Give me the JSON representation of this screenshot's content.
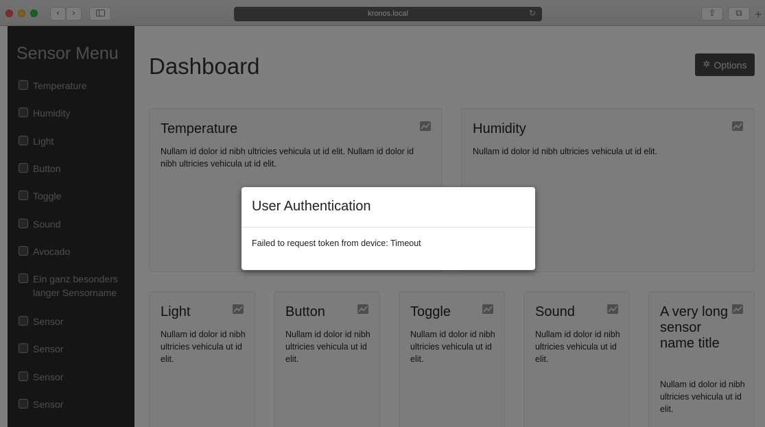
{
  "browser": {
    "url": "kronos.local",
    "back_glyph": "‹",
    "forward_glyph": "›",
    "reload_glyph": "↻",
    "share_glyph": "⇪",
    "tabs_glyph": "⧉",
    "new_tab_glyph": "+"
  },
  "sidebar": {
    "title": "Sensor Menu",
    "items": [
      {
        "label": "Temperature",
        "checked": false
      },
      {
        "label": "Humidity",
        "checked": false
      },
      {
        "label": "Light",
        "checked": false
      },
      {
        "label": "Button",
        "checked": false
      },
      {
        "label": "Toggle",
        "checked": false
      },
      {
        "label": "Sound",
        "checked": false
      },
      {
        "label": "Avocado",
        "checked": false
      },
      {
        "label": "Ein ganz besonders langer Sensorname",
        "checked": false
      },
      {
        "label": "Sensor",
        "checked": false
      },
      {
        "label": "Sensor",
        "checked": false
      },
      {
        "label": "Sensor",
        "checked": false
      },
      {
        "label": "Sensor",
        "checked": false
      }
    ]
  },
  "main": {
    "title": "Dashboard",
    "options_label": "Options",
    "options_icon": "gear-icon",
    "cards": [
      {
        "title": "Temperature",
        "text": "Nullam id dolor id nibh ultricies vehicula ut id elit. Nullam id dolor id nibh ultricies vehicula ut id elit."
      },
      {
        "title": "Humidity",
        "text": "Nullam id dolor id nibh ultricies vehicula ut id elit."
      },
      {
        "title": "Light",
        "text": "Nullam id dolor id nibh ultricies vehicula ut id elit."
      },
      {
        "title": "Button",
        "text": "Nullam id dolor id nibh ultricies vehicula ut id elit."
      },
      {
        "title": "Toggle",
        "text": "Nullam id dolor id nibh ultricies vehicula ut id elit."
      },
      {
        "title": "Sound",
        "text": "Nullam id dolor id nibh ultricies vehicula ut id elit."
      },
      {
        "title": "A very long sensor name title",
        "text": "Nullam id dolor id nibh ultricies vehicula ut id elit."
      }
    ]
  },
  "modal": {
    "title": "User Authentication",
    "message": "Failed to request token from device: Timeout"
  },
  "colors": {
    "sidebar_bg": "#2b2b2b",
    "overlay": "rgba(0,0,0,0.5)",
    "options_button": "#474747",
    "url_bar": "#5d5d5d"
  }
}
